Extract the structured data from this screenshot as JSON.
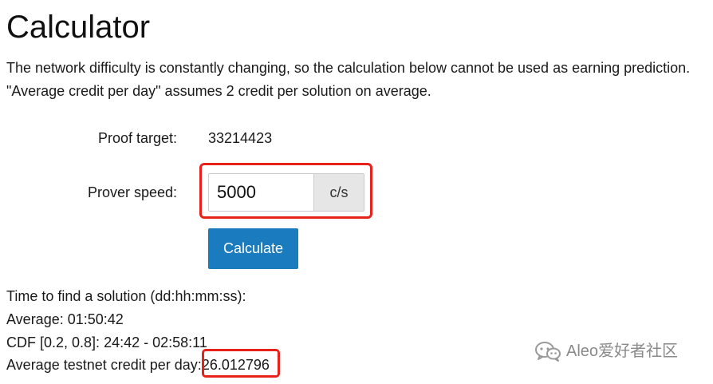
{
  "page": {
    "title": "Calculator",
    "description_line1": "The network difficulty is constantly changing, so the calculation below cannot be used as earning prediction.",
    "description_line2": "\"Average credit per day\" assumes 2 credit per solution on average."
  },
  "form": {
    "proof_target_label": "Proof target:",
    "proof_target_value": "33214423",
    "prover_speed_label": "Prover speed:",
    "prover_speed_value": "5000",
    "prover_speed_unit": "c/s",
    "calculate_button": "Calculate"
  },
  "results": {
    "time_heading": "Time to find a solution (dd:hh:mm:ss):",
    "average_label": "Average:",
    "average_value": "01:50:42",
    "cdf_label": "CDF [0.2, 0.8]:",
    "cdf_value": "24:42 - 02:58:11",
    "credit_label": "Average testnet credit per day:",
    "credit_value": "26.012796"
  },
  "watermark": {
    "text": "Aleo爱好者社区",
    "icon": "wechat-icon"
  },
  "colors": {
    "primary_button": "#1b7bbf",
    "highlight": "#e8221b",
    "addon_background": "#e6e6e6"
  }
}
